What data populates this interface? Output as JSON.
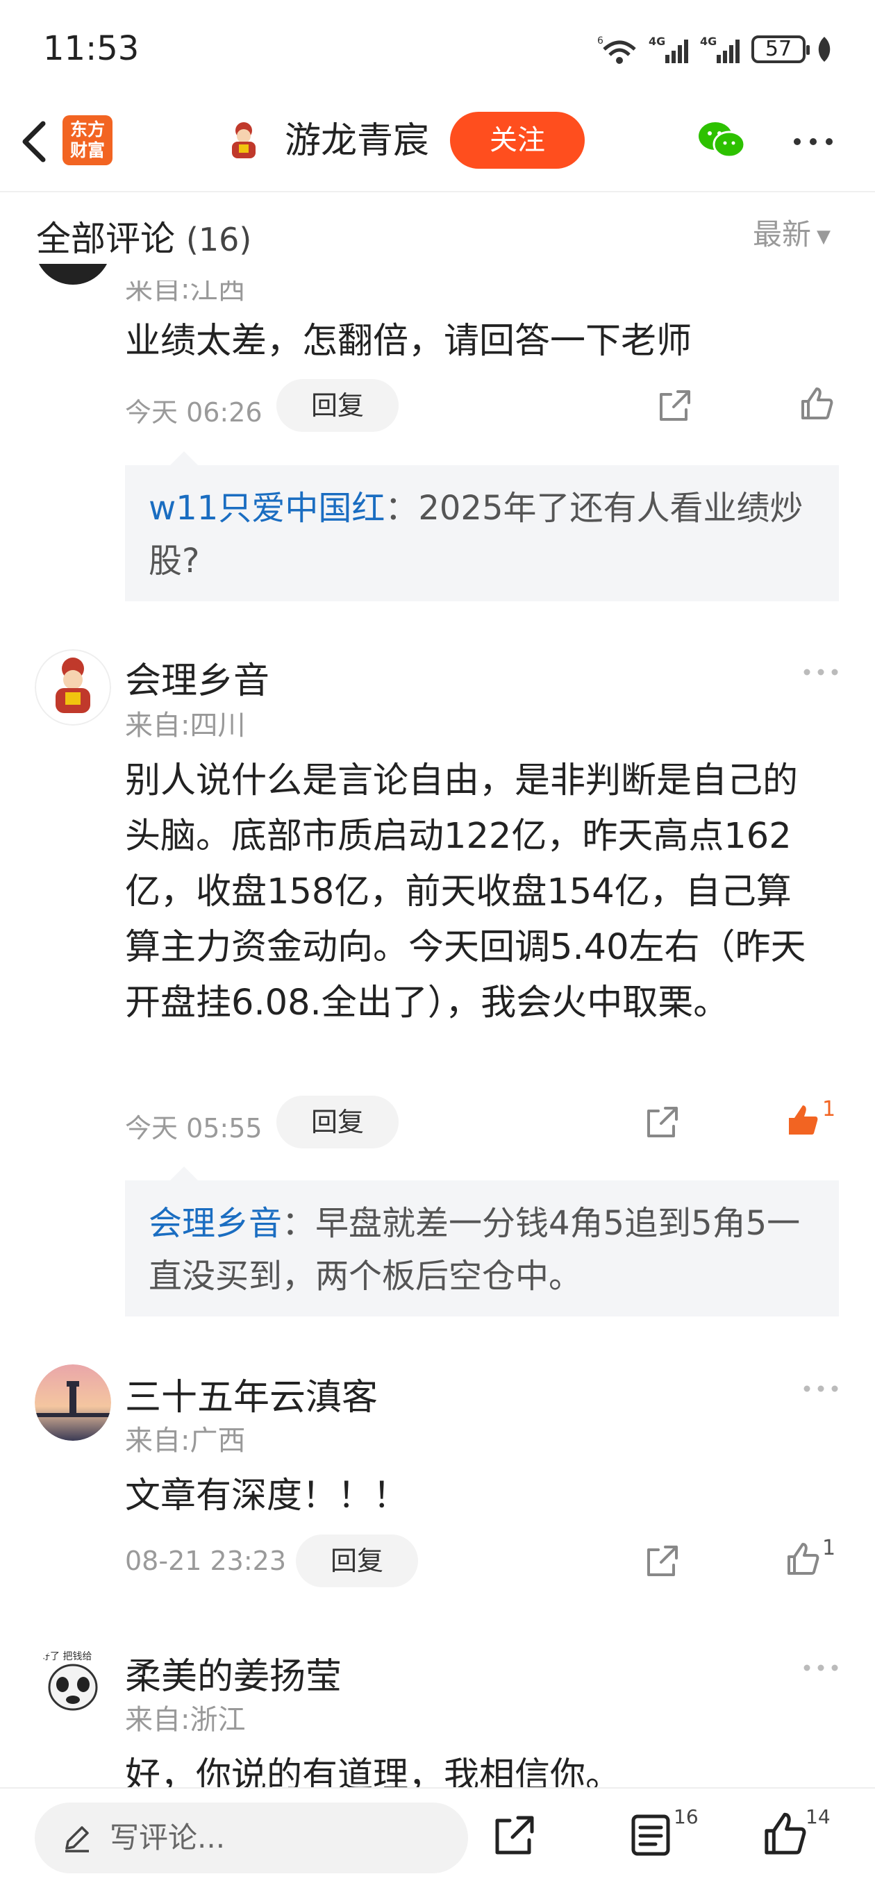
{
  "status": {
    "time": "11:53",
    "battery": "57",
    "net1": "6",
    "net2": "4G",
    "net3": "4G"
  },
  "header": {
    "logo_line1": "东方",
    "logo_line2": "财富",
    "author": "游龙青宸",
    "follow_label": "关注"
  },
  "comments_header": {
    "title": "全部评论",
    "count": "(16)",
    "sort_label": "最新"
  },
  "comments": [
    {
      "region": "来自:江西",
      "content": "业绩太差，怎翻倍，请回答一下老师",
      "time": "今天 06:26",
      "reply_label": "回复",
      "reply": {
        "name": "w11只爱中国红",
        "text": "：2025年了还有人看业绩炒股?"
      }
    },
    {
      "name": "会理乡音",
      "region": "来自:四川",
      "content": "别人说什么是言论自由，是非判断是自己的头脑。底部市质启动122亿，昨天高点162亿，收盘158亿，前天收盘154亿，自己算算主力资金动向。今天回调5.40左右（昨天开盘挂6.08.全出了），我会火中取栗。",
      "time": "今天 05:55",
      "reply_label": "回复",
      "likes": "1",
      "liked": true,
      "reply": {
        "name": "会理乡音",
        "text": "：早盘就差一分钱4角5追到5角5一直没买到，两个板后空仓中。"
      }
    },
    {
      "name": "三十五年云滇客",
      "region": "来自:广西",
      "content": "文章有深度！！！",
      "time": "08-21 23:23",
      "reply_label": "回复",
      "likes": "1"
    },
    {
      "name": "柔美的姜扬莹",
      "region": "来自:浙江",
      "content": "好，你说的有道理，我相信你。",
      "avatar_text": "好了 把钱给"
    }
  ],
  "bottom_bar": {
    "placeholder": "写评论...",
    "comment_count": "16",
    "like_count": "14"
  },
  "colors": {
    "accent": "#ff4e1e",
    "link_blue": "#1a6dc1",
    "liked": "#f26422"
  },
  "icons": [
    "back-icon",
    "wechat-icon",
    "more-icon",
    "share-icon",
    "thumb-up-icon",
    "pencil-icon",
    "list-icon"
  ]
}
